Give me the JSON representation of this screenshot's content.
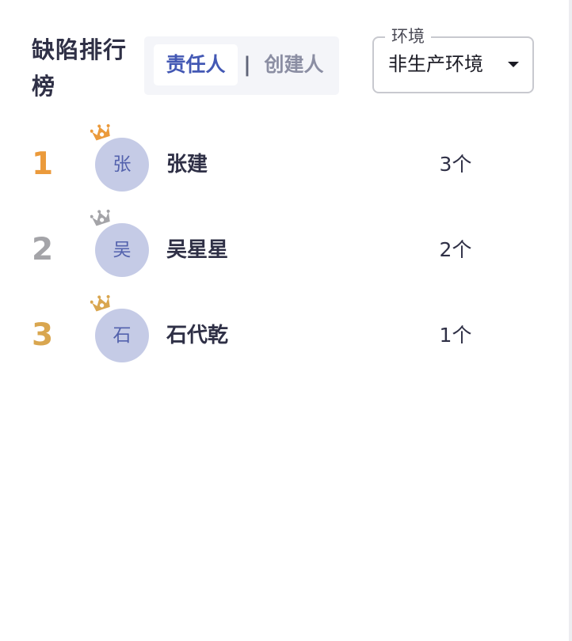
{
  "title": "缺陷排行榜",
  "tabs": {
    "active": "责任人",
    "separator": "|",
    "inactive": "创建人"
  },
  "environment": {
    "legend": "环境",
    "value": "非生产环境"
  },
  "colors": {
    "rank_gold": "#eb9a3b",
    "rank_silver": "#a4a4a8",
    "rank_bronze": "#d9a64f",
    "avatar_bg": "#c5cbe6",
    "avatar_text": "#5362ad",
    "accent": "#4358b4"
  },
  "ranking": [
    {
      "rank": "1",
      "avatar": "张",
      "name": "张建",
      "count": "3个",
      "crown": "gold-crown-icon"
    },
    {
      "rank": "2",
      "avatar": "吴",
      "name": "吴星星",
      "count": "2个",
      "crown": "silver-crown-icon"
    },
    {
      "rank": "3",
      "avatar": "石",
      "name": "石代乾",
      "count": "1个",
      "crown": "bronze-crown-icon"
    }
  ]
}
